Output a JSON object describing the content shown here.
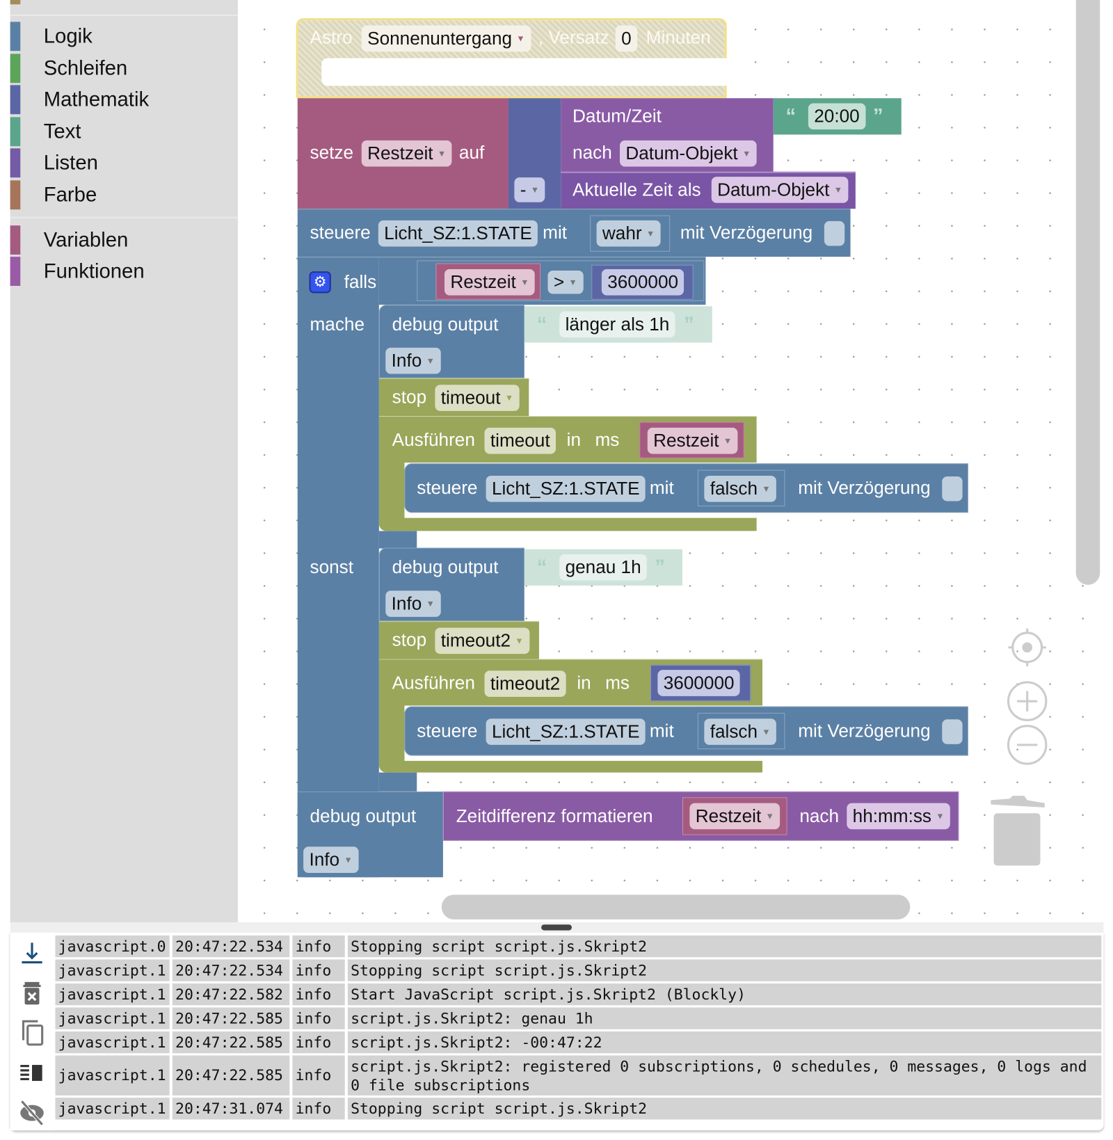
{
  "sidebar": {
    "items": [
      {
        "label": "Logik",
        "color": "#5b80a5"
      },
      {
        "label": "Schleifen",
        "color": "#5ba55b"
      },
      {
        "label": "Mathematik",
        "color": "#5b67a5"
      },
      {
        "label": "Text",
        "color": "#5ba58c"
      },
      {
        "label": "Listen",
        "color": "#745ba5"
      },
      {
        "label": "Farbe",
        "color": "#a5745b"
      },
      {
        "label": "Variablen",
        "color": "#a55b80"
      },
      {
        "label": "Funktionen",
        "color": "#995ba5"
      }
    ],
    "partial_item_color": "#a58c5b"
  },
  "blocks": {
    "astro": {
      "label": "Astro",
      "event": "Sonnenuntergang",
      "offset_label": ", Versatz",
      "offset": "0",
      "unit": "Minuten"
    },
    "set_var": {
      "label": "setze",
      "var": "Restzeit",
      "to": "auf",
      "op": "-"
    },
    "datetime": {
      "label": "Datum/Zeit",
      "to_label": "nach",
      "format": "Datum-Objekt",
      "value": "20:00"
    },
    "now": {
      "label": "Aktuelle Zeit als",
      "format": "Datum-Objekt"
    },
    "control1": {
      "label": "steuere",
      "object": "Licht_SZ:1.STATE",
      "with": "mit",
      "value": "wahr",
      "delay": "mit Verzögerung"
    },
    "if": {
      "label": "falls",
      "var": "Restzeit",
      "op": ">",
      "number": "3600000",
      "do": "mache",
      "else": "sonst"
    },
    "debug1": {
      "label": "debug output",
      "text": "länger als 1h",
      "level": "Info"
    },
    "stop1": {
      "label": "stop",
      "timer": "timeout"
    },
    "exec1": {
      "label": "Ausführen",
      "timer": "timeout",
      "in": "in",
      "ms": "ms",
      "var": "Restzeit"
    },
    "control2": {
      "label": "steuere",
      "object": "Licht_SZ:1.STATE",
      "with": "mit",
      "value": "falsch",
      "delay": "mit Verzögerung"
    },
    "debug2": {
      "label": "debug output",
      "text": "genau 1h",
      "level": "Info"
    },
    "stop2": {
      "label": "stop",
      "timer": "timeout2"
    },
    "exec2": {
      "label": "Ausführen",
      "timer": "timeout2",
      "in": "in",
      "ms": "ms",
      "number": "3600000"
    },
    "control3": {
      "label": "steuere",
      "object": "Licht_SZ:1.STATE",
      "with": "mit",
      "value": "falsch",
      "delay": "mit Verzögerung"
    },
    "debug3": {
      "label": "debug output",
      "fn": "Zeitdifferenz formatieren",
      "var": "Restzeit",
      "to": "nach",
      "format": "hh:mm:ss",
      "level": "Info"
    }
  },
  "quote_open": "“",
  "quote_close": "”",
  "log": {
    "rows": [
      {
        "source": "javascript.0",
        "time": "20:47:22.534",
        "level": "info",
        "message": "Stopping script script.js.Skript2"
      },
      {
        "source": "javascript.1",
        "time": "20:47:22.534",
        "level": "info",
        "message": "Stopping script script.js.Skript2"
      },
      {
        "source": "javascript.1",
        "time": "20:47:22.582",
        "level": "info",
        "message": "Start JavaScript script.js.Skript2 (Blockly)"
      },
      {
        "source": "javascript.1",
        "time": "20:47:22.585",
        "level": "info",
        "message": "script.js.Skript2: genau 1h"
      },
      {
        "source": "javascript.1",
        "time": "20:47:22.585",
        "level": "info",
        "message": "script.js.Skript2: -00:47:22"
      },
      {
        "source": "javascript.1",
        "time": "20:47:22.585",
        "level": "info",
        "message": "script.js.Skript2: registered 0 subscriptions, 0 schedules, 0 messages, 0 logs and 0 file subscriptions"
      },
      {
        "source": "javascript.1",
        "time": "20:47:31.074",
        "level": "info",
        "message": "Stopping script script.js.Skript2"
      }
    ],
    "tools": [
      "scroll-to-bottom-icon",
      "clear-log-icon",
      "copy-icon",
      "layout-toggle-icon",
      "hide-log-icon"
    ]
  }
}
